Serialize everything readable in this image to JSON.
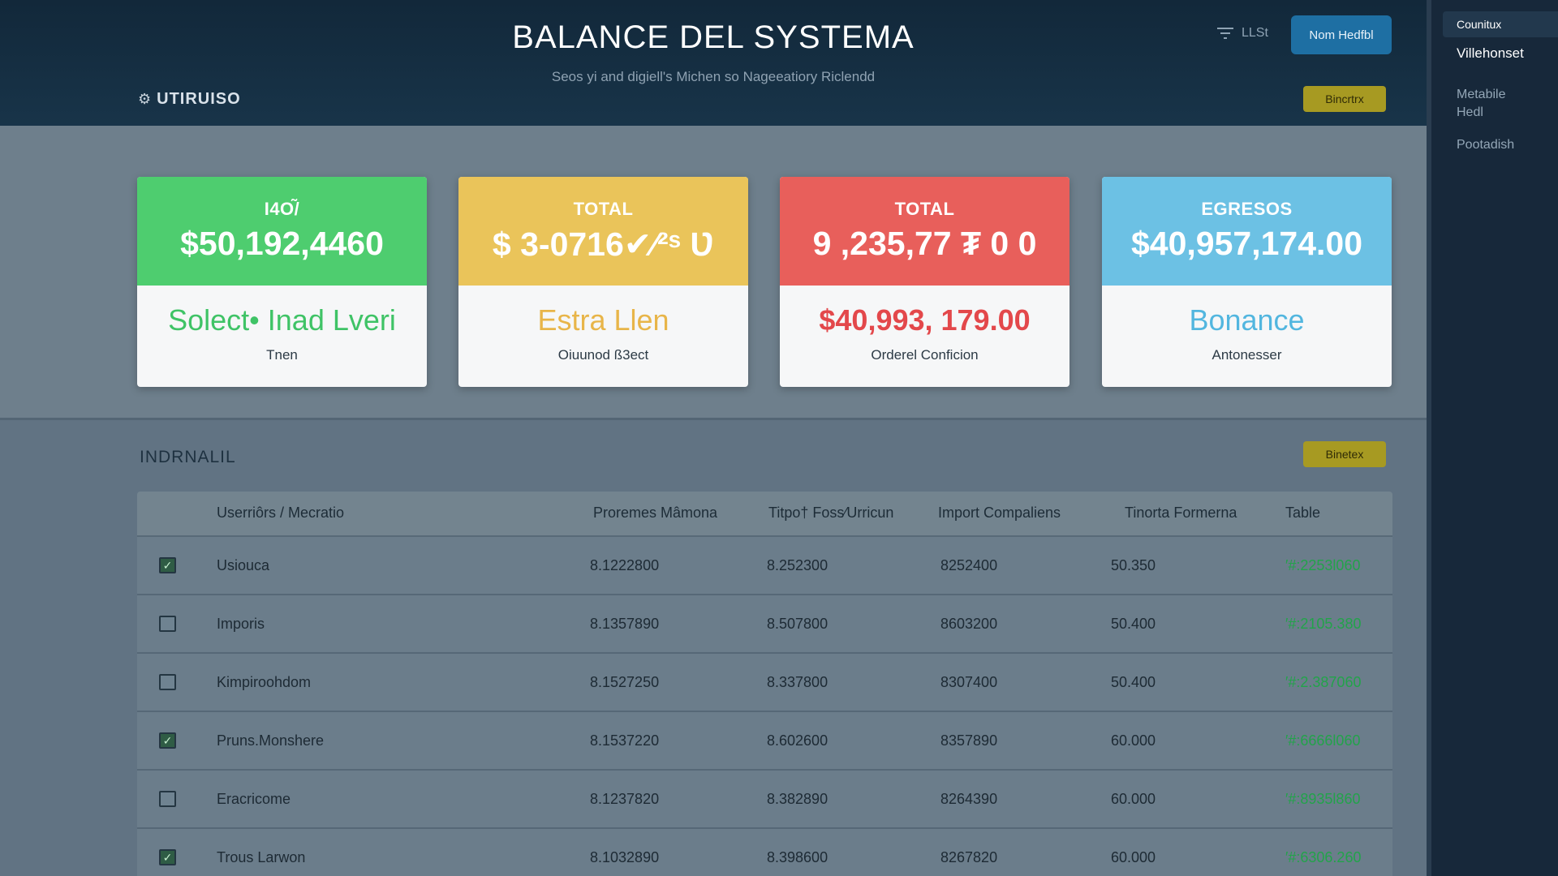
{
  "header": {
    "title": "BALANCE DEL SYSTEMA",
    "subtitle": "Seos yi and digiell's Michen so Nageeatiory Riclendd",
    "brand": "UTIRUISO",
    "filter_label": "LLSt",
    "primary_button": "Nom Hedfbl",
    "badge_button": "Bincrtrx"
  },
  "cards": [
    {
      "label": "I4O/̃",
      "amount": "$50,192,4460",
      "headline": "Solect• Inad Lveri",
      "caption": "Tnen"
    },
    {
      "label": "TOTAL",
      "amount": "$ 3-0716✔︎⁄²ˢ Ʋ",
      "headline": "Estra Llen",
      "caption": "Oiuunod ß3ect"
    },
    {
      "label": "TOTAL",
      "amount": "9 ,235,77 ₮ 0 0",
      "headline": "$40,993, 179.00",
      "caption": "Orderel Conficion"
    },
    {
      "label": "EGRESOS",
      "amount": "$40,957,174.00",
      "headline": "Bonance",
      "caption": "Antonesser"
    }
  ],
  "section": {
    "title": "INDRNALIL",
    "button": "Binetex"
  },
  "table": {
    "headers": [
      "Userriôrs / Mecratio",
      "Proremes Mâmona",
      "Titpo† Foss⁄Urricun",
      "Import Compaliens",
      "Tinorta Formerna",
      "Table"
    ],
    "rows": [
      {
        "user": "Usiouca",
        "a": "8.1222800",
        "b": "8.252300",
        "c": "8252400",
        "d": "50.350",
        "e": "′#:2253l060",
        "checked": true
      },
      {
        "user": "Imporis",
        "a": "8.1357890",
        "b": "8.507800",
        "c": "8603200",
        "d": "50.400",
        "e": "′#:2105.380",
        "checked": false
      },
      {
        "user": "Kimpiroohdom",
        "a": "8.1527250",
        "b": "8.337800",
        "c": "8307400",
        "d": "50.400",
        "e": "′#:2.387060",
        "checked": false
      },
      {
        "user": "Pruns.Monshere",
        "a": "8.1537220",
        "b": "8.602600",
        "c": "8357890",
        "d": "60.000",
        "e": "′#:6666l060",
        "checked": true
      },
      {
        "user": "Eracricome",
        "a": "8.1237820",
        "b": "8.382890",
        "c": "8264390",
        "d": "60.000",
        "e": "′#:8935l860",
        "checked": false
      },
      {
        "user": "Trous Larwon",
        "a": "8.1032890",
        "b": "8.398600",
        "c": "8267820",
        "d": "60.000",
        "e": "′#:6306.260",
        "checked": true
      }
    ]
  },
  "sidebar": {
    "items": [
      "Counitux",
      "Villehonset",
      "Metabile Hedl",
      "Pootadish"
    ]
  },
  "colors": {
    "green": "#4ecd6f",
    "yellow": "#eac45a",
    "red": "#e85f5b",
    "blue": "#6cc1e4",
    "header_bg": "#12283a",
    "primary": "#1e6fa3",
    "olive": "#a79a22"
  },
  "icons": [
    "gear-icon",
    "filter-icon",
    "checkbox-icon"
  ]
}
